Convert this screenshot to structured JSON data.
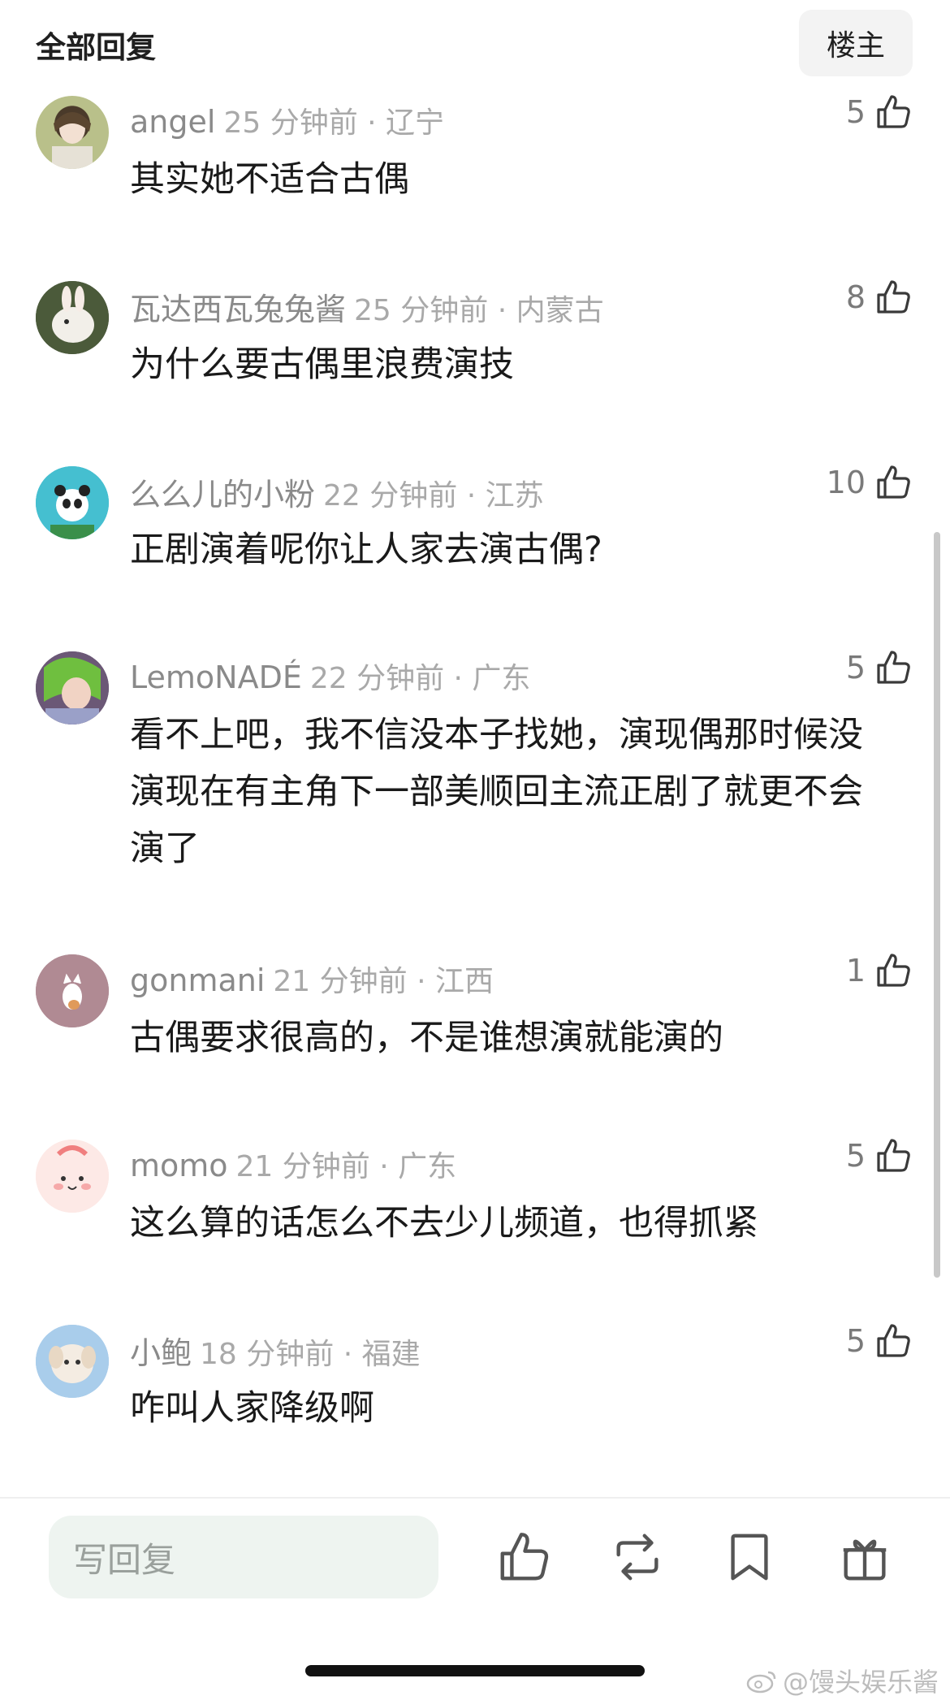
{
  "header": {
    "title": "全部回复",
    "host_button": "楼主"
  },
  "comments": [
    {
      "user": "angel",
      "info": "25 分钟前 · 辽宁",
      "text": "其实她不适合古偶",
      "likes": "5"
    },
    {
      "user": "瓦达西瓦兔兔酱",
      "info": "25 分钟前 · 内蒙古",
      "text": "为什么要古偶里浪费演技",
      "likes": "8"
    },
    {
      "user": "么么儿的小粉",
      "info": "22 分钟前 · 江苏",
      "text": "正剧演着呢你让人家去演古偶?",
      "likes": "10"
    },
    {
      "user": "LemoNADÉ",
      "info": "22 分钟前 · 广东",
      "text": "看不上吧，我不信没本子找她，演现偶那时候没演现在有主角下一部美顺回主流正剧了就更不会演了",
      "likes": "5"
    },
    {
      "user": "gonmani",
      "info": "21 分钟前 · 江西",
      "text": "古偶要求很高的，不是谁想演就能演的",
      "likes": "1"
    },
    {
      "user": "momo",
      "info": "21 分钟前 · 广东",
      "text": "这么算的话怎么不去少儿频道，也得抓紧",
      "likes": "5"
    },
    {
      "user": "小鲍",
      "info": "18 分钟前 · 福建",
      "text": "咋叫人家降级啊",
      "likes": "5"
    }
  ],
  "bottom_bar": {
    "reply_placeholder": "写回复"
  },
  "watermark": "@馒头娱乐酱"
}
